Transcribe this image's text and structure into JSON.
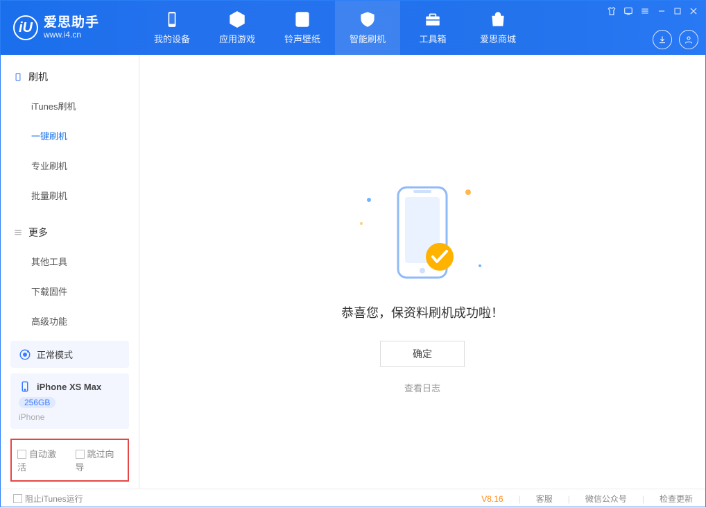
{
  "app": {
    "name": "爱思助手",
    "url": "www.i4.cn"
  },
  "nav": {
    "items": [
      {
        "label": "我的设备"
      },
      {
        "label": "应用游戏"
      },
      {
        "label": "铃声壁纸"
      },
      {
        "label": "智能刷机"
      },
      {
        "label": "工具箱"
      },
      {
        "label": "爱思商城"
      }
    ],
    "active_index": 3
  },
  "sidebar": {
    "group1": {
      "title": "刷机",
      "items": [
        {
          "label": "iTunes刷机"
        },
        {
          "label": "一键刷机"
        },
        {
          "label": "专业刷机"
        },
        {
          "label": "批量刷机"
        }
      ],
      "active_index": 1
    },
    "group2": {
      "title": "更多",
      "items": [
        {
          "label": "其他工具"
        },
        {
          "label": "下载固件"
        },
        {
          "label": "高级功能"
        }
      ]
    },
    "mode": "正常模式",
    "device": {
      "name": "iPhone XS Max",
      "capacity": "256GB",
      "type": "iPhone"
    },
    "checks": {
      "auto_activate": "自动激活",
      "skip_guide": "跳过向导"
    }
  },
  "content": {
    "message": "恭喜您，保资料刷机成功啦！",
    "ok_button": "确定",
    "view_log": "查看日志"
  },
  "footer": {
    "block_itunes": "阻止iTunes运行",
    "version": "V8.16",
    "links": {
      "support": "客服",
      "wechat": "微信公众号",
      "check_update": "检查更新"
    }
  }
}
